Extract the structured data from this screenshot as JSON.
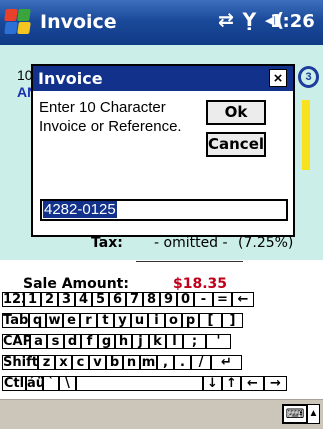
{
  "taskbar": {
    "title": "Invoice",
    "status_icons": "⇄ Ỵ ◂(",
    "time": "1:26",
    "logo_colors": [
      "#e8402a",
      "#3aa53a",
      "#2c6fd6",
      "#f6c520"
    ]
  },
  "background": {
    "fragment_top": "10",
    "fragment_blue": "AN",
    "circle_text": "3",
    "tax_label": "Tax:",
    "tax_value": "- omitted -",
    "tax_percent": "(7.25%)",
    "sale_label": "Sale Amount:",
    "sale_value": "$18.35"
  },
  "dialog": {
    "title": "Invoice",
    "close_label": "×",
    "message": "Enter 10 Character Invoice or Reference.",
    "ok_label": "Ok",
    "cancel_label": "Cancel",
    "input_value": "4282-0125"
  },
  "keyboard": {
    "rows": [
      [
        "123",
        "1",
        "2",
        "3",
        "4",
        "5",
        "6",
        "7",
        "8",
        "9",
        "0",
        "-",
        "=",
        "←"
      ],
      [
        "Tab",
        "q",
        "w",
        "e",
        "r",
        "t",
        "y",
        "u",
        "i",
        "o",
        "p",
        "[",
        "]"
      ],
      [
        "CAP",
        "a",
        "s",
        "d",
        "f",
        "g",
        "h",
        "j",
        "k",
        "l",
        ";",
        "'"
      ],
      [
        "Shift",
        "z",
        "x",
        "c",
        "v",
        "b",
        "n",
        "m",
        ",",
        ".",
        "/",
        "↵"
      ],
      [
        "Ctl",
        "áü",
        "`",
        "\\",
        "",
        "↓",
        "↑",
        "←",
        "→"
      ]
    ]
  },
  "bottombar": {
    "kb_icon": "⌨",
    "kb_arrow": "▲"
  }
}
